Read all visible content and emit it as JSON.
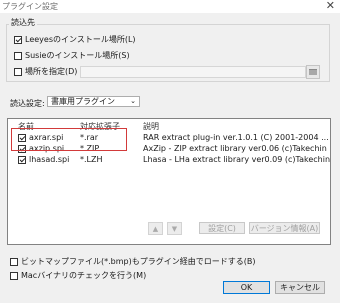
{
  "window": {
    "title": "プラグイン設定",
    "close_glyph": "✕"
  },
  "load_source": {
    "label": "読込先",
    "leeyes_install": {
      "label": "Leeyesのインストール場所(L)",
      "checked": true
    },
    "susie_install": {
      "label": "Susieのインストール場所(S)",
      "checked": false
    },
    "custom_location": {
      "label": "場所を指定(D)",
      "checked": false,
      "path_value": ""
    }
  },
  "load_settings": {
    "label": "読込設定:",
    "selected": "書庫用プラグイン",
    "arrow": "⌄"
  },
  "plugin_list": {
    "headers": {
      "name": "名前",
      "ext": "対応拡張子",
      "desc": "説明"
    },
    "rows": [
      {
        "name": "axrar.spi",
        "ext": "*.rar",
        "desc": "RAR extract plug-in ver.1.0.1 (C) 2001-2004 ...",
        "checked": true
      },
      {
        "name": "axzip.spi",
        "ext": "*.ZIP",
        "desc": "AxZip - ZIP extract library ver0.06 (c)Takechin",
        "checked": true
      },
      {
        "name": "lhasad.spi",
        "ext": "*.LZH",
        "desc": "Lhasa - LHa extract library ver0.09 (c)Takechin",
        "checked": true
      }
    ]
  },
  "list_buttons": {
    "move_up": "▲",
    "move_down": "▼",
    "settings": "設定(C)",
    "version_info": "バージョン情報(A)"
  },
  "options": {
    "bitmap_via_plugin": {
      "label": "ビットマップファイル(*.bmp)もプラグイン経由でロードする(B)",
      "checked": false
    },
    "mac_binary_check": {
      "label": "Macバイナリのチェックを行う(M)",
      "checked": false
    }
  },
  "dialog_buttons": {
    "ok": "OK",
    "cancel": "キャンセル"
  }
}
